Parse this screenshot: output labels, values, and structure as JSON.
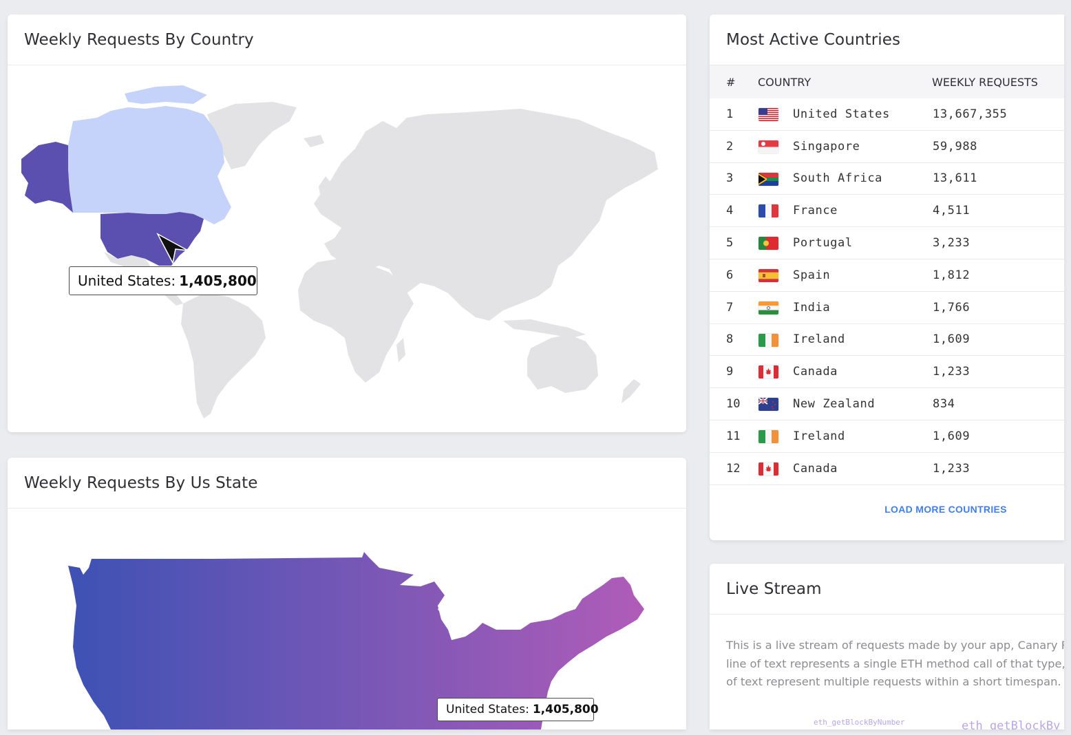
{
  "world_card": {
    "title": "Weekly Requests By Country",
    "tooltip": {
      "country": "United States:",
      "value": "1,405,800"
    }
  },
  "state_card": {
    "title": "Weekly Requests By Us State",
    "tooltip": {
      "country": "United States:",
      "value": "1,405,800"
    }
  },
  "countries_card": {
    "title": "Most Active Countries",
    "columns": {
      "num": "#",
      "country": "COUNTRY",
      "requests": "WEEKLY REQUESTS"
    },
    "rows": [
      {
        "num": "1",
        "flag": "us-flag-icon",
        "country": "United States",
        "requests": "13,667,355"
      },
      {
        "num": "2",
        "flag": "sg-flag-icon",
        "country": "Singapore",
        "requests": "59,988"
      },
      {
        "num": "3",
        "flag": "za-flag-icon",
        "country": "South Africa",
        "requests": "13,611"
      },
      {
        "num": "4",
        "flag": "fr-flag-icon",
        "country": "France",
        "requests": "4,511"
      },
      {
        "num": "5",
        "flag": "pt-flag-icon",
        "country": "Portugal",
        "requests": "3,233"
      },
      {
        "num": "6",
        "flag": "es-flag-icon",
        "country": "Spain",
        "requests": "1,812"
      },
      {
        "num": "7",
        "flag": "in-flag-icon",
        "country": "India",
        "requests": "1,766"
      },
      {
        "num": "8",
        "flag": "ie-flag-icon",
        "country": "Ireland",
        "requests": "1,609"
      },
      {
        "num": "9",
        "flag": "ca-flag-icon",
        "country": "Canada",
        "requests": "1,233"
      },
      {
        "num": "10",
        "flag": "nz-flag-icon",
        "country": "New Zealand",
        "requests": "834"
      },
      {
        "num": "11",
        "flag": "ie-flag-icon",
        "country": "Ireland",
        "requests": "1,609"
      },
      {
        "num": "12",
        "flag": "ca-flag-icon",
        "country": "Canada",
        "requests": "1,233"
      }
    ],
    "load_more": "LOAD MORE COUNTRIES"
  },
  "live_card": {
    "title": "Live Stream",
    "line1": "This is a live stream of requests made by your app, Canary Ri",
    "line2": "line of text represents a single ETH method call of that type,",
    "line3": "of text represent multiple requests within a short timespan.",
    "stream_small": "eth_getBlockByNumber",
    "stream_large": "eth_getBlockBy"
  },
  "colors": {
    "highlight_country": "#5b4fb0",
    "canada": "#c5d3fb",
    "land": "#e3e3e5",
    "gradient_start": "#3d52b4",
    "gradient_end": "#b05cb8",
    "link": "#3f7ef2"
  }
}
